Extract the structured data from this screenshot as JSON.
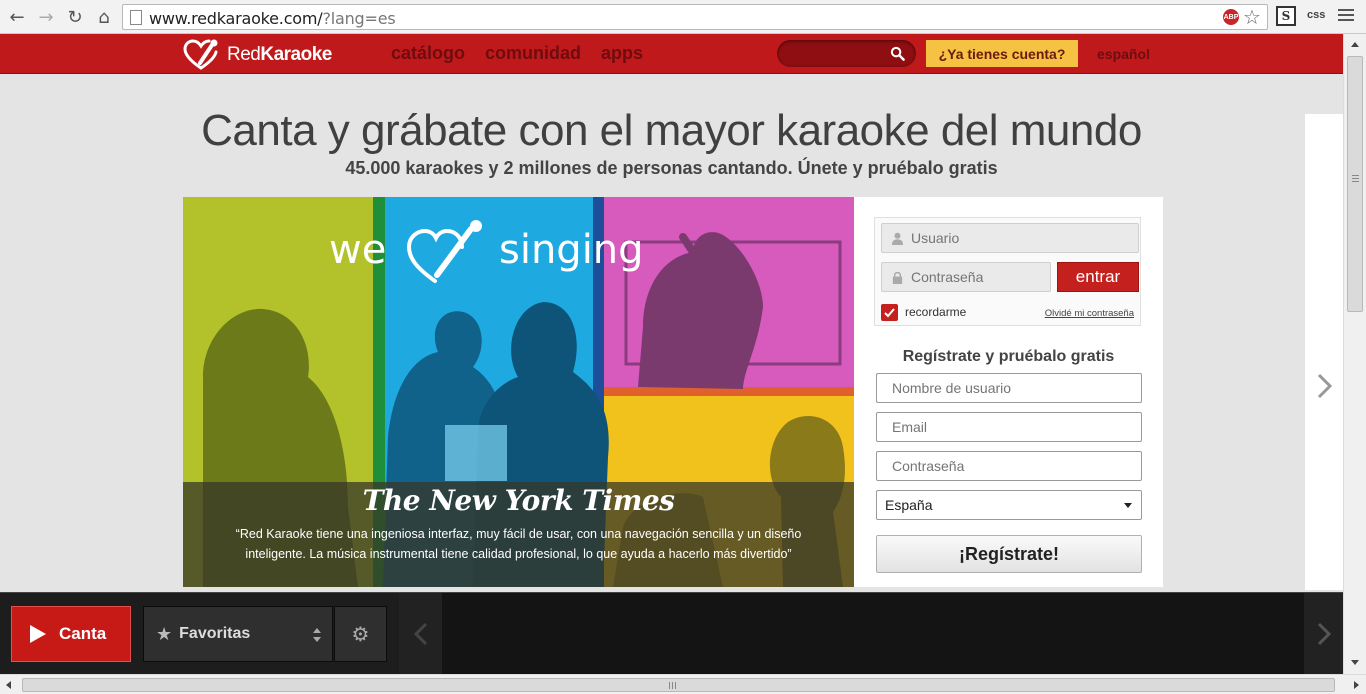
{
  "browser": {
    "url_host": "www.redkaraoke.com/",
    "url_query": "?lang=es",
    "abp_label": "ABP",
    "ext_css_label": "css",
    "ext_s_label": "S"
  },
  "header": {
    "logo_text_plain": "Red",
    "logo_text_bold": "Karaoke",
    "nav": [
      "catálogo",
      "comunidad",
      "apps"
    ],
    "search_placeholder": "",
    "account_label": "¿Ya tienes cuenta?",
    "language_label": "español"
  },
  "hero": {
    "title": "Canta y grábate con el mayor karaoke del mundo",
    "subtitle": "45.000 karaokes y 2 millones de personas cantando. Únete y pruébalo gratis"
  },
  "banner": {
    "slogan_we": "we",
    "slogan_singing": "singing",
    "quote_source": "The New York Times",
    "quote_line1": "“Red Karaoke tiene una ingeniosa interfaz, muy fácil de usar, con una navegación sencilla y un diseño",
    "quote_line2": "inteligente. La música instrumental tiene calidad profesional, lo que ayuda a hacerlo más divertido”"
  },
  "login": {
    "username_placeholder": "Usuario",
    "password_placeholder": "Contraseña",
    "enter_label": "entrar",
    "remember_label": "recordarme",
    "remember_checked": true,
    "forgot_label": "Olvidé mi contraseña"
  },
  "register": {
    "title": "Regístrate y pruébalo gratis",
    "username_placeholder": "Nombre de usuario",
    "email_placeholder": "Email",
    "password_placeholder": "Contraseña",
    "country_selected": "España",
    "submit_label": "¡Regístrate!"
  },
  "player": {
    "sing_label": "Canta",
    "favorites_label": "Favoritas"
  },
  "colors": {
    "brand_red": "#c0191c",
    "account_yellow": "#f5c244",
    "lime": "#b5c42b",
    "blue": "#1ea9e1",
    "magenta": "#d65bbd",
    "yellow": "#f2c21c"
  }
}
